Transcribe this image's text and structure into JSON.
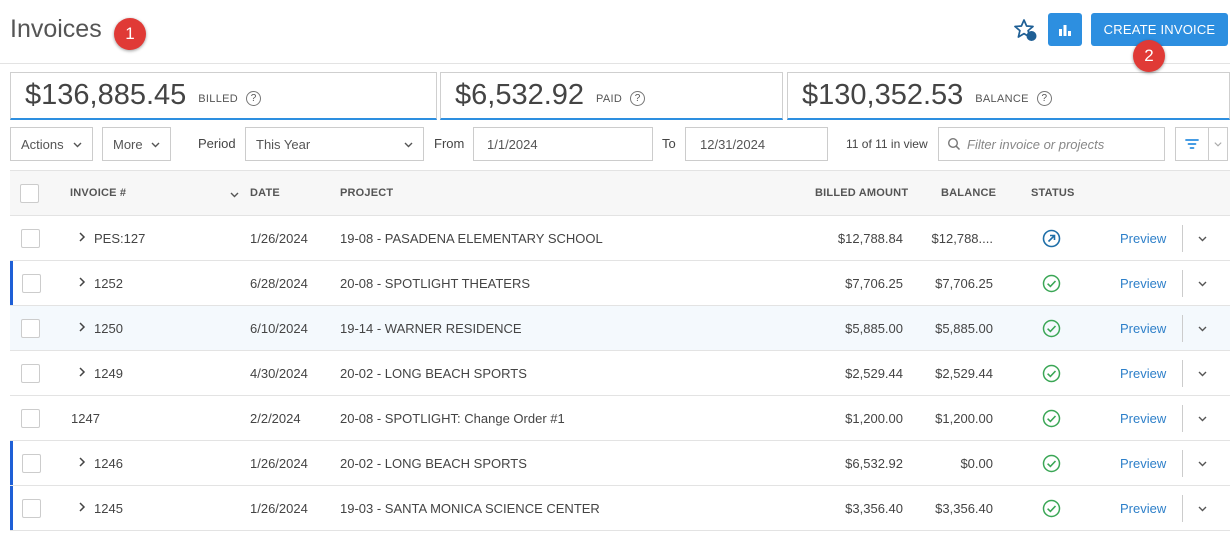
{
  "header": {
    "title": "Invoices",
    "create_label": "CREATE INVOICE",
    "marker_1": "1",
    "marker_2": "2"
  },
  "summary": {
    "billed": {
      "amount": "$136,885.45",
      "label": "BILLED"
    },
    "paid": {
      "amount": "$6,532.92",
      "label": "PAID"
    },
    "balance": {
      "amount": "$130,352.53",
      "label": "BALANCE"
    },
    "help": "?"
  },
  "controls": {
    "actions_label": "Actions",
    "more_label": "More",
    "period_label": "Period",
    "period_value": "This Year",
    "from_label": "From",
    "from_value": "1/1/2024",
    "to_label": "To",
    "to_value": "12/31/2024",
    "view_count": "11 of 11 in view",
    "search_placeholder": "Filter invoice or projects"
  },
  "table": {
    "columns": {
      "invoice": "INVOICE #",
      "date": "DATE",
      "project": "PROJECT",
      "billed": "BILLED AMOUNT",
      "balance": "BALANCE",
      "status": "STATUS"
    },
    "preview_label": "Preview",
    "rows": [
      {
        "invoice": "PES:127",
        "date": "1/26/2024",
        "project": "19-08 - PASADENA ELEMENTARY SCHOOL",
        "billed": "$12,788.84",
        "balance": "$12,788....",
        "status": "sent"
      },
      {
        "invoice": "1252",
        "date": "6/28/2024",
        "project": "20-08 - SPOTLIGHT THEATERS",
        "billed": "$7,706.25",
        "balance": "$7,706.25",
        "status": "approved"
      },
      {
        "invoice": "1250",
        "date": "6/10/2024",
        "project": "19-14 - WARNER RESIDENCE",
        "billed": "$5,885.00",
        "balance": "$5,885.00",
        "status": "approved"
      },
      {
        "invoice": "1249",
        "date": "4/30/2024",
        "project": "20-02 - LONG BEACH SPORTS",
        "billed": "$2,529.44",
        "balance": "$2,529.44",
        "status": "approved"
      },
      {
        "invoice": "1247",
        "date": "2/2/2024",
        "project": "20-08 - SPOTLIGHT: Change Order #1",
        "billed": "$1,200.00",
        "balance": "$1,200.00",
        "status": "approved"
      },
      {
        "invoice": "1246",
        "date": "1/26/2024",
        "project": "20-02 - LONG BEACH SPORTS",
        "billed": "$6,532.92",
        "balance": "$0.00",
        "status": "approved"
      },
      {
        "invoice": "1245",
        "date": "1/26/2024",
        "project": "19-03 - SANTA MONICA SCIENCE CENTER",
        "billed": "$3,356.40",
        "balance": "$3,356.40",
        "status": "approved"
      }
    ]
  },
  "colors": {
    "accent": "#2d8fe0",
    "marker": "#e03a36",
    "status_ok": "#3aa655",
    "status_sent": "#1f6fa8",
    "row_bar": "#1e5fd6"
  },
  "icons": [
    "star-icon",
    "chart-icon",
    "help-icon",
    "chevron-down-icon",
    "search-icon",
    "filter-icon",
    "chevron-right-icon",
    "check-circle-icon",
    "arrow-circle-icon"
  ]
}
